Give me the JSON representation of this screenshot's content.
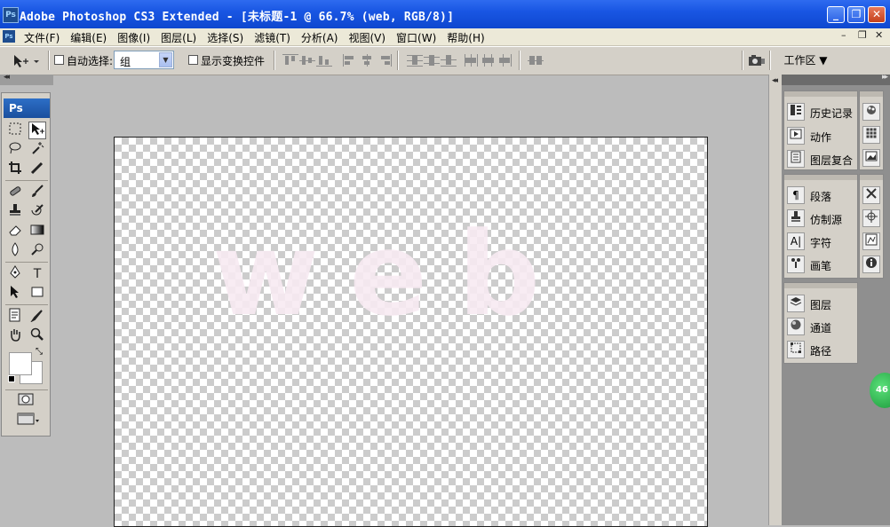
{
  "window": {
    "app_icon": "Ps",
    "title": "Adobe Photoshop CS3 Extended - [未标题-1 @ 66.7% (web, RGB/8)]",
    "minimize": "_",
    "maximize": "❐",
    "close": "✕"
  },
  "menu": {
    "doc_icon": "Ps",
    "items": [
      "文件(F)",
      "编辑(E)",
      "图像(I)",
      "图层(L)",
      "选择(S)",
      "滤镜(T)",
      "分析(A)",
      "视图(V)",
      "窗口(W)",
      "帮助(H)"
    ],
    "mdi_minimize": "–",
    "mdi_restore": "❐",
    "mdi_close": "✕"
  },
  "options": {
    "auto_select_label": "自动选择:",
    "auto_select_value": "组",
    "show_transform_label": "显示变换控件",
    "workspace_label": "工作区 ▼"
  },
  "toolbox": {
    "badge": "Ps",
    "swap_glyph": "⤡"
  },
  "canvas": {
    "text_layer": "web"
  },
  "panels": {
    "group1": [
      "历史记录",
      "动作",
      "图层复合"
    ],
    "group2": [
      "段落",
      "仿制源",
      "字符",
      "画笔"
    ],
    "group3": [
      "图层",
      "通道",
      "路径"
    ]
  },
  "badge": {
    "value": "46"
  }
}
